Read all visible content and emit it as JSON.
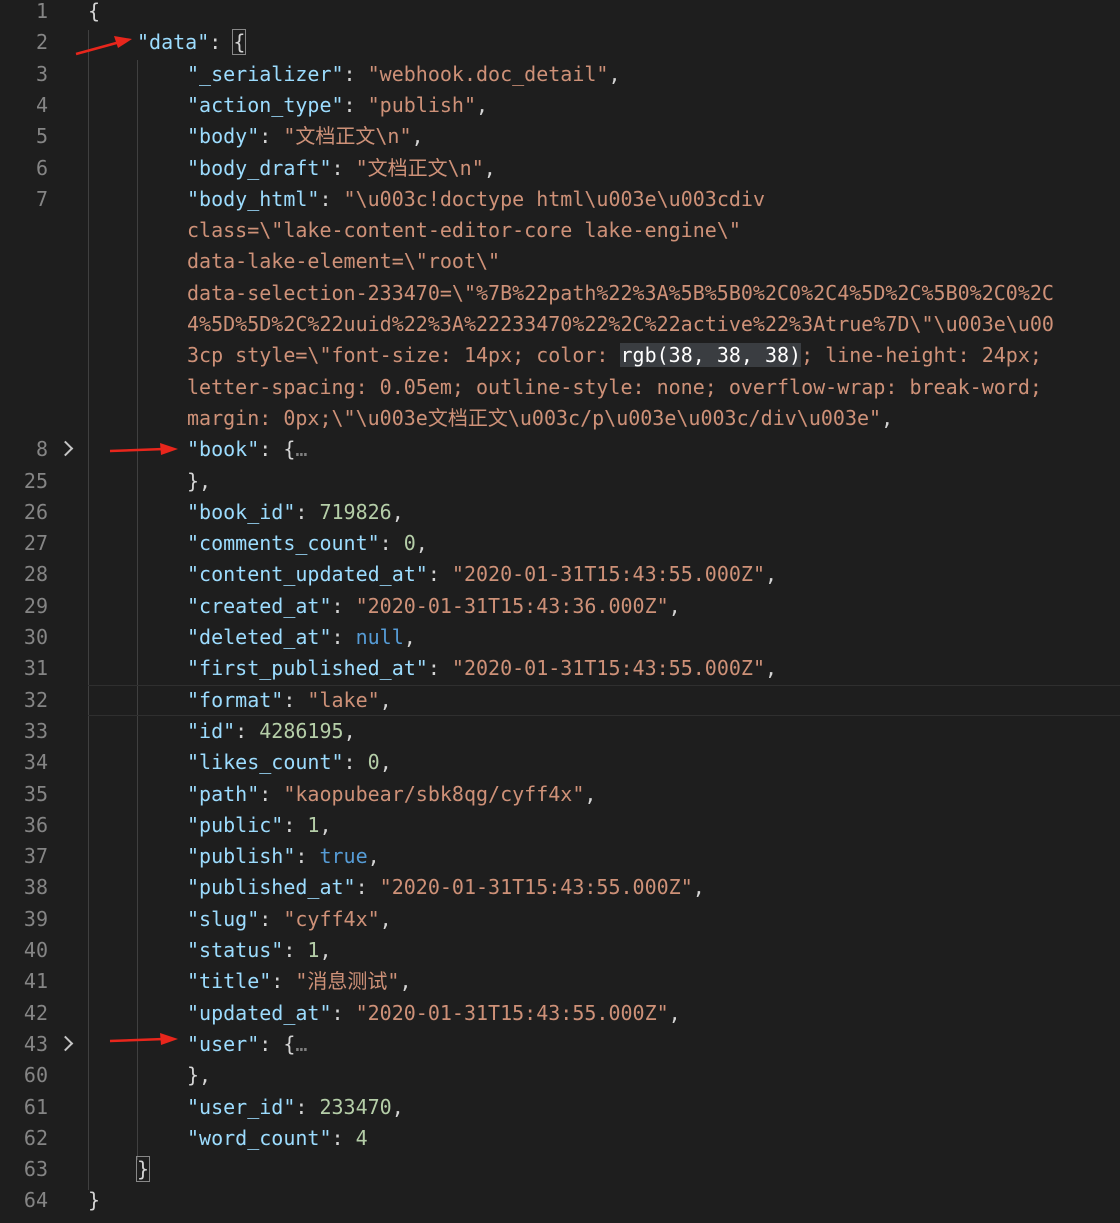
{
  "lines": [
    {
      "ln": "1",
      "indent": 0,
      "tokens": [
        [
          "p",
          "{"
        ]
      ]
    },
    {
      "ln": "2",
      "indent": 1,
      "tokens": [
        [
          "k",
          "\"data\""
        ],
        [
          "p",
          ": "
        ],
        [
          "pb",
          "{"
        ]
      ]
    },
    {
      "ln": "3",
      "indent": 2,
      "tokens": [
        [
          "k",
          "\"_serializer\""
        ],
        [
          "p",
          ": "
        ],
        [
          "s",
          "\"webhook.doc_detail\""
        ],
        [
          "p",
          ","
        ]
      ]
    },
    {
      "ln": "4",
      "indent": 2,
      "tokens": [
        [
          "k",
          "\"action_type\""
        ],
        [
          "p",
          ": "
        ],
        [
          "s",
          "\"publish\""
        ],
        [
          "p",
          ","
        ]
      ]
    },
    {
      "ln": "5",
      "indent": 2,
      "tokens": [
        [
          "k",
          "\"body\""
        ],
        [
          "p",
          ": "
        ],
        [
          "s",
          "\"文档正文\\n\""
        ],
        [
          "p",
          ","
        ]
      ]
    },
    {
      "ln": "6",
      "indent": 2,
      "tokens": [
        [
          "k",
          "\"body_draft\""
        ],
        [
          "p",
          ": "
        ],
        [
          "s",
          "\"文档正文\\n\""
        ],
        [
          "p",
          ","
        ]
      ]
    },
    {
      "ln": "7",
      "indent": 2,
      "tokens": [
        [
          "k",
          "\"body_html\""
        ],
        [
          "p",
          ": "
        ],
        [
          "s",
          "\"\\u003c!doctype html\\u003e\\u003cdiv"
        ]
      ]
    },
    {
      "ln": "",
      "indent": 2,
      "tokens": [
        [
          "s",
          "class=\\\"lake-content-editor-core lake-engine\\\""
        ]
      ]
    },
    {
      "ln": "",
      "indent": 2,
      "tokens": [
        [
          "s",
          "data-lake-element=\\\"root\\\""
        ]
      ]
    },
    {
      "ln": "",
      "indent": 2,
      "tokens": [
        [
          "s",
          "data-selection-233470=\\\"%7B%22path%22%3A%5B%5B0%2C0%2C4%5D%2C%5B0%2C0%2C"
        ]
      ]
    },
    {
      "ln": "",
      "indent": 2,
      "tokens": [
        [
          "s",
          "4%5D%5D%2C%22uuid%22%3A%22233470%22%2C%22active%22%3Atrue%7D\\\"\\u003e\\u00"
        ]
      ]
    },
    {
      "ln": "",
      "indent": 2,
      "tokens": [
        [
          "s",
          "3cp style=\\\"font-size: 14px; color: "
        ],
        [
          "hl",
          "rgb(38, 38, 38)"
        ],
        [
          "s",
          "; line-height: 24px;"
        ]
      ]
    },
    {
      "ln": "",
      "indent": 2,
      "tokens": [
        [
          "s",
          "letter-spacing: 0.05em; outline-style: none; overflow-wrap: break-word;"
        ]
      ]
    },
    {
      "ln": "",
      "indent": 2,
      "tokens": [
        [
          "s",
          "margin: 0px;\\\"\\u003e文档正文\\u003c/p\\u003e\\u003c/div\\u003e\""
        ],
        [
          "p",
          ","
        ]
      ]
    },
    {
      "ln": "8",
      "indent": 2,
      "fold": true,
      "tokens": [
        [
          "k",
          "\"book\""
        ],
        [
          "p",
          ": {"
        ],
        [
          "ell",
          "…"
        ]
      ]
    },
    {
      "ln": "25",
      "indent": 2,
      "tokens": [
        [
          "p",
          "},"
        ]
      ]
    },
    {
      "ln": "26",
      "indent": 2,
      "tokens": [
        [
          "k",
          "\"book_id\""
        ],
        [
          "p",
          ": "
        ],
        [
          "n",
          "719826"
        ],
        [
          "p",
          ","
        ]
      ]
    },
    {
      "ln": "27",
      "indent": 2,
      "tokens": [
        [
          "k",
          "\"comments_count\""
        ],
        [
          "p",
          ": "
        ],
        [
          "n",
          "0"
        ],
        [
          "p",
          ","
        ]
      ]
    },
    {
      "ln": "28",
      "indent": 2,
      "tokens": [
        [
          "k",
          "\"content_updated_at\""
        ],
        [
          "p",
          ": "
        ],
        [
          "s",
          "\"2020-01-31T15:43:55.000Z\""
        ],
        [
          "p",
          ","
        ]
      ]
    },
    {
      "ln": "29",
      "indent": 2,
      "tokens": [
        [
          "k",
          "\"created_at\""
        ],
        [
          "p",
          ": "
        ],
        [
          "s",
          "\"2020-01-31T15:43:36.000Z\""
        ],
        [
          "p",
          ","
        ]
      ]
    },
    {
      "ln": "30",
      "indent": 2,
      "tokens": [
        [
          "k",
          "\"deleted_at\""
        ],
        [
          "p",
          ": "
        ],
        [
          "kw",
          "null"
        ],
        [
          "p",
          ","
        ]
      ]
    },
    {
      "ln": "31",
      "indent": 2,
      "tokens": [
        [
          "k",
          "\"first_published_at\""
        ],
        [
          "p",
          ": "
        ],
        [
          "s",
          "\"2020-01-31T15:43:55.000Z\""
        ],
        [
          "p",
          ","
        ]
      ]
    },
    {
      "ln": "32",
      "indent": 2,
      "tokens": [
        [
          "k",
          "\"format\""
        ],
        [
          "p",
          ": "
        ],
        [
          "s",
          "\"lake\""
        ],
        [
          "p",
          ","
        ]
      ]
    },
    {
      "ln": "33",
      "indent": 2,
      "tokens": [
        [
          "k",
          "\"id\""
        ],
        [
          "p",
          ": "
        ],
        [
          "n",
          "4286195"
        ],
        [
          "p",
          ","
        ]
      ]
    },
    {
      "ln": "34",
      "indent": 2,
      "tokens": [
        [
          "k",
          "\"likes_count\""
        ],
        [
          "p",
          ": "
        ],
        [
          "n",
          "0"
        ],
        [
          "p",
          ","
        ]
      ]
    },
    {
      "ln": "35",
      "indent": 2,
      "tokens": [
        [
          "k",
          "\"path\""
        ],
        [
          "p",
          ": "
        ],
        [
          "s",
          "\"kaopubear/sbk8qg/cyff4x\""
        ],
        [
          "p",
          ","
        ]
      ]
    },
    {
      "ln": "36",
      "indent": 2,
      "tokens": [
        [
          "k",
          "\"public\""
        ],
        [
          "p",
          ": "
        ],
        [
          "n",
          "1"
        ],
        [
          "p",
          ","
        ]
      ]
    },
    {
      "ln": "37",
      "indent": 2,
      "tokens": [
        [
          "k",
          "\"publish\""
        ],
        [
          "p",
          ": "
        ],
        [
          "kw",
          "true"
        ],
        [
          "p",
          ","
        ]
      ]
    },
    {
      "ln": "38",
      "indent": 2,
      "tokens": [
        [
          "k",
          "\"published_at\""
        ],
        [
          "p",
          ": "
        ],
        [
          "s",
          "\"2020-01-31T15:43:55.000Z\""
        ],
        [
          "p",
          ","
        ]
      ]
    },
    {
      "ln": "39",
      "indent": 2,
      "tokens": [
        [
          "k",
          "\"slug\""
        ],
        [
          "p",
          ": "
        ],
        [
          "s",
          "\"cyff4x\""
        ],
        [
          "p",
          ","
        ]
      ]
    },
    {
      "ln": "40",
      "indent": 2,
      "tokens": [
        [
          "k",
          "\"status\""
        ],
        [
          "p",
          ": "
        ],
        [
          "n",
          "1"
        ],
        [
          "p",
          ","
        ]
      ]
    },
    {
      "ln": "41",
      "indent": 2,
      "tokens": [
        [
          "k",
          "\"title\""
        ],
        [
          "p",
          ": "
        ],
        [
          "s",
          "\"消息测试\""
        ],
        [
          "p",
          ","
        ]
      ]
    },
    {
      "ln": "42",
      "indent": 2,
      "tokens": [
        [
          "k",
          "\"updated_at\""
        ],
        [
          "p",
          ": "
        ],
        [
          "s",
          "\"2020-01-31T15:43:55.000Z\""
        ],
        [
          "p",
          ","
        ]
      ]
    },
    {
      "ln": "43",
      "indent": 2,
      "fold": true,
      "tokens": [
        [
          "k",
          "\"user\""
        ],
        [
          "p",
          ": {"
        ],
        [
          "ell",
          "…"
        ]
      ]
    },
    {
      "ln": "60",
      "indent": 2,
      "tokens": [
        [
          "p",
          "},"
        ]
      ]
    },
    {
      "ln": "61",
      "indent": 2,
      "tokens": [
        [
          "k",
          "\"user_id\""
        ],
        [
          "p",
          ": "
        ],
        [
          "n",
          "233470"
        ],
        [
          "p",
          ","
        ]
      ]
    },
    {
      "ln": "62",
      "indent": 2,
      "tokens": [
        [
          "k",
          "\"word_count\""
        ],
        [
          "p",
          ": "
        ],
        [
          "n",
          "4"
        ]
      ]
    },
    {
      "ln": "63",
      "indent": 1,
      "tokens": [
        [
          "pb",
          "}"
        ]
      ]
    },
    {
      "ln": "64",
      "indent": 0,
      "tokens": [
        [
          "p",
          "}"
        ]
      ]
    }
  ],
  "icons": {
    "fold": "chevron-right-icon",
    "arrow": "red-arrow-annotation-icon"
  },
  "colors": {
    "background": "#1e1e1e",
    "key": "#9cdcfe",
    "string": "#ce9178",
    "number": "#b5cea8",
    "keyword": "#569cd6",
    "arrow": "#e8261c"
  }
}
